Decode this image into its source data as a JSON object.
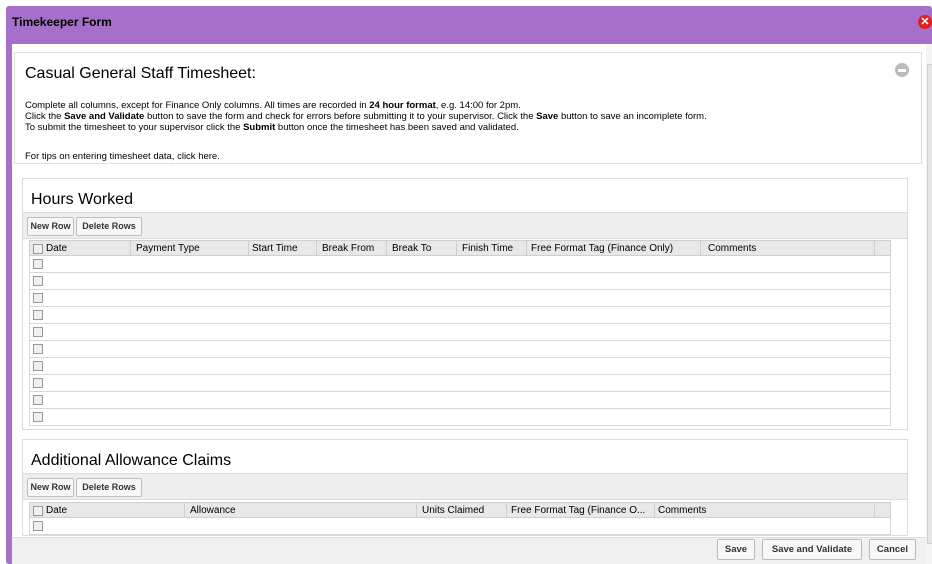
{
  "window": {
    "title": "Timekeeper Form"
  },
  "intro": {
    "heading": "Casual General Staff Timesheet:",
    "line1_a": "Complete all columns, except for Finance Only columns. All times are recorded in ",
    "line1_b": "24 hour format",
    "line1_c": ", e.g. 14:00 for 2pm.",
    "line2_a": "Click the ",
    "line2_b": "Save and Validate",
    "line2_c": " button to save the form and check for errors before submitting it to your supervisor. Click the ",
    "line2_d": "Save",
    "line2_e": " button to save an incomplete form.",
    "line3_a": "To submit the timesheet to your supervisor click the ",
    "line3_b": "Submit",
    "line3_c": " button once the timesheet has been saved and validated.",
    "tips": "For tips on entering timesheet data, click here."
  },
  "hours": {
    "title": "Hours Worked",
    "new_row": "New Row",
    "delete_rows": "Delete Rows",
    "columns": [
      "Date",
      "Payment Type",
      "Start Time",
      "Break From",
      "Break To",
      "Finish Time",
      "Free Format Tag (Finance Only)",
      "Comments"
    ],
    "row_count": 10
  },
  "allowance": {
    "title": "Additional Allowance Claims",
    "new_row": "New Row",
    "delete_rows": "Delete Rows",
    "columns": [
      "Date",
      "Allowance",
      "Units Claimed",
      "Free Format Tag (Finance O...",
      "Comments"
    ],
    "row_count": 1
  },
  "footer": {
    "save": "Save",
    "save_validate": "Save and Validate",
    "cancel": "Cancel"
  },
  "colors": {
    "titlebar": "#a66fc9",
    "close": "#e02020"
  }
}
